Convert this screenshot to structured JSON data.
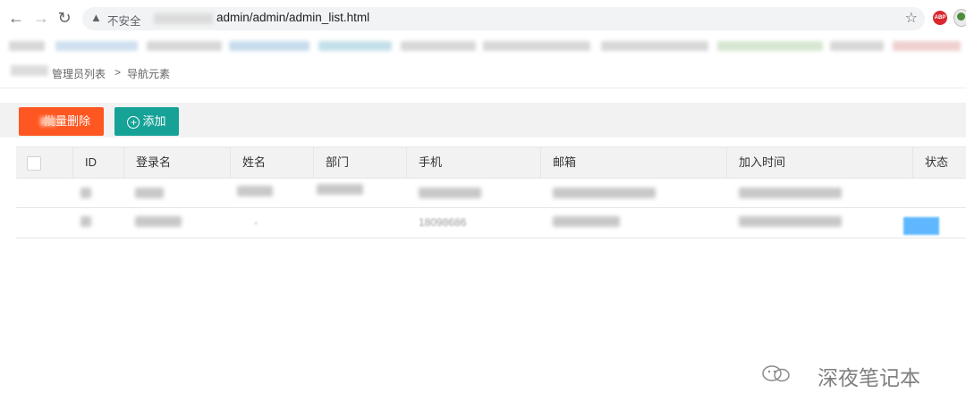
{
  "browser": {
    "security_label": "不安全",
    "url": "admin/admin/admin_list.html",
    "back_icon": "←",
    "forward_icon": "→",
    "reload_icon": "↻",
    "warning_icon": "▲",
    "star_icon": "☆",
    "abp_label": "ABP"
  },
  "breadcrumb": {
    "current": "管理员列表",
    "separator": ">",
    "last": "导航元素"
  },
  "actions": {
    "delete_label": "批量删除",
    "add_label": "添加",
    "add_icon": "+",
    "delete_color": "#ff5722",
    "add_color": "#16a297"
  },
  "table": {
    "columns": [
      "ID",
      "登录名",
      "姓名",
      "部门",
      "手机",
      "邮箱",
      "加入时间",
      "状态"
    ],
    "row2_partial": {
      "name": "-",
      "phone": "18098686"
    }
  },
  "watermark": {
    "text": "深夜笔记本"
  }
}
